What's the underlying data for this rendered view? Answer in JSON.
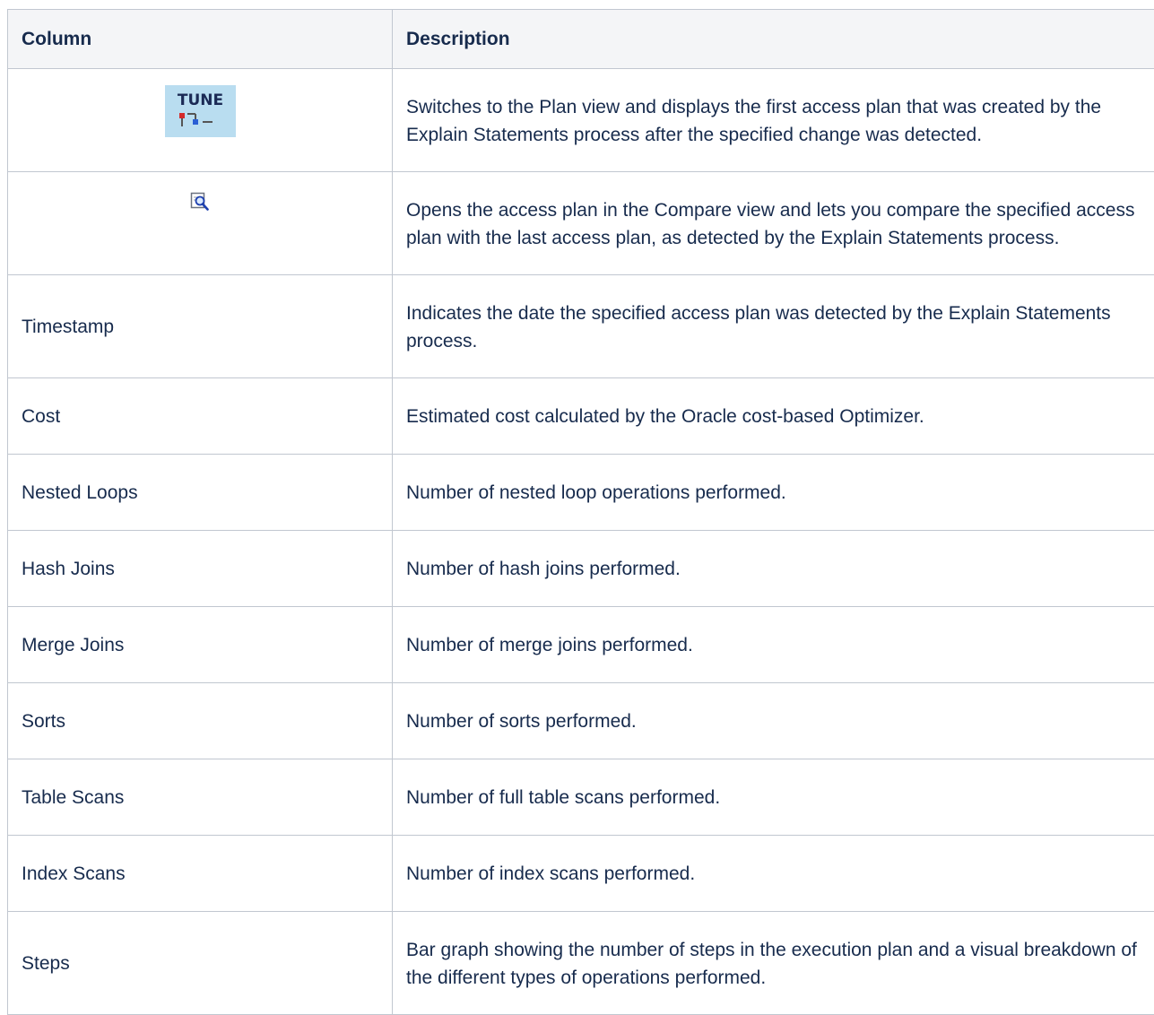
{
  "table": {
    "headers": {
      "column": "Column",
      "description": "Description"
    },
    "rows": [
      {
        "icon": "tune-icon",
        "icon_text": "TUNE",
        "description": "Switches to the Plan view and displays the first access plan that was created by the Explain Statements process after the specified change was detected."
      },
      {
        "icon": "compare-icon",
        "description": "Opens the access plan in the Compare view and lets you compare the specified access plan with the last access plan, as detected by the Explain Statements process."
      },
      {
        "column": "Timestamp",
        "description": "Indicates the date the specified access plan was detected by the Explain Statements process."
      },
      {
        "column": "Cost",
        "description": "Estimated cost calculated by the Oracle cost-based Optimizer."
      },
      {
        "column": "Nested Loops",
        "description": "Number of nested loop operations performed."
      },
      {
        "column": "Hash Joins",
        "description": "Number of hash joins performed."
      },
      {
        "column": "Merge Joins",
        "description": "Number of merge joins performed."
      },
      {
        "column": "Sorts",
        "description": "Number of sorts performed."
      },
      {
        "column": "Table Scans",
        "description": "Number of full table scans performed."
      },
      {
        "column": "Index Scans",
        "description": "Number of index scans performed."
      },
      {
        "column": "Steps",
        "description": "Bar graph showing the number of steps in the execution plan and a visual breakdown of the different types of operations performed."
      }
    ]
  },
  "colors": {
    "text": "#172b4d",
    "border": "#c1c7d0",
    "header_bg": "#f4f5f7",
    "tune_icon_bg": "#b9ddf0"
  }
}
